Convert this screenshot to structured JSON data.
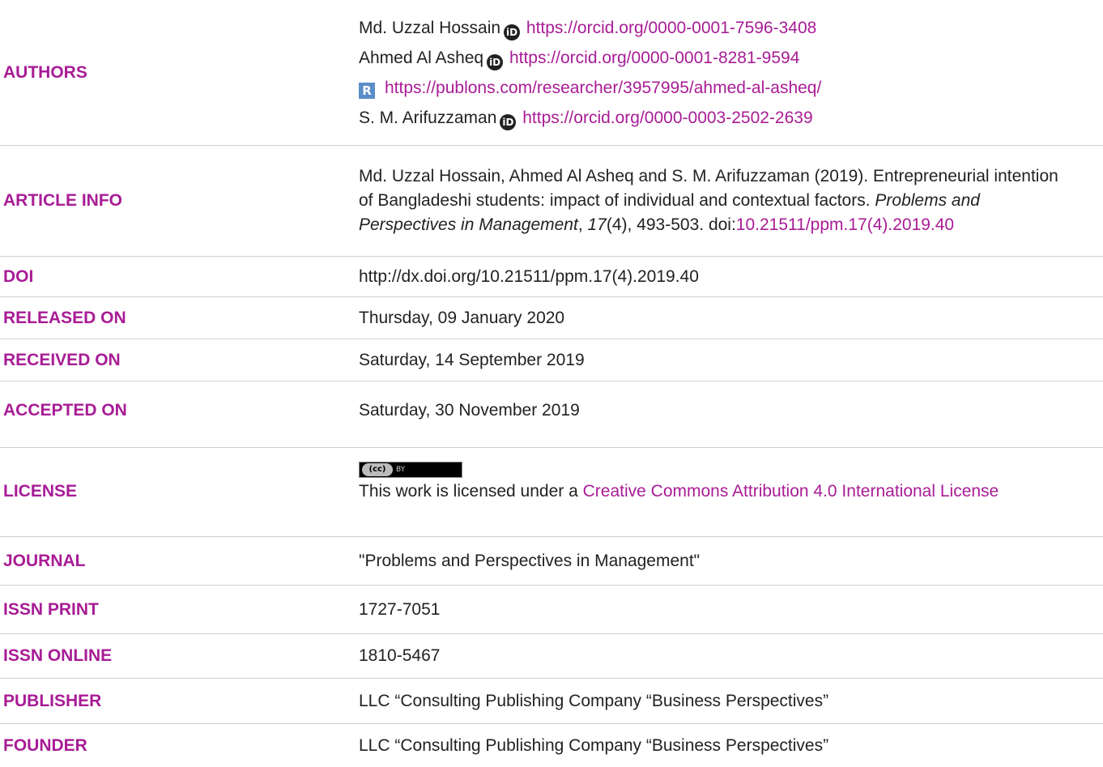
{
  "authors": {
    "label": "AUTHORS",
    "people": [
      {
        "name": "Md. Uzzal Hossain",
        "orcid": "https://orcid.org/0000-0001-7596-3408"
      },
      {
        "name": "Ahmed Al Asheq",
        "orcid": "https://orcid.org/0000-0001-8281-9594",
        "publons": "https://publons.com/researcher/3957995/ahmed-al-asheq/"
      },
      {
        "name": "S. M. Arifuzzaman",
        "orcid": "https://orcid.org/0000-0003-2502-2639"
      }
    ]
  },
  "article_info": {
    "label": "ARTICLE INFO",
    "citation_authors": "Md. Uzzal Hossain, Ahmed Al Asheq and S. M. Arifuzzaman (2019).",
    "citation_title": "Entrepreneurial intention of Bangladeshi students: impact of individual and contextual factors.",
    "journal_name": "Problems and Perspectives in Management",
    "volume": "17",
    "issue_pages": "(4), 493-503.",
    "doi_prefix": "doi:",
    "doi_link": "10.21511/ppm.17(4).2019.40"
  },
  "doi": {
    "label": "DOI",
    "value": "http://dx.doi.org/10.21511/ppm.17(4).2019.40"
  },
  "released_on": {
    "label": "RELEASED ON",
    "value": "Thursday, 09 January 2020"
  },
  "received_on": {
    "label": "RECEIVED ON",
    "value": "Saturday, 14 September 2019"
  },
  "accepted_on": {
    "label": "ACCEPTED ON",
    "value": "Saturday, 30 November 2019"
  },
  "license": {
    "label": "LICENSE",
    "text": "This work is licensed under a ",
    "link_text": "Creative Commons Attribution 4.0 International License"
  },
  "journal": {
    "label": "JOURNAL",
    "value": "\"Problems and Perspectives in Management\""
  },
  "issn_print": {
    "label": "ISSN PRINT",
    "value": "1727-7051"
  },
  "issn_online": {
    "label": "ISSN ONLINE",
    "value": "1810-5467"
  },
  "publisher": {
    "label": "PUBLISHER",
    "value": "LLC “Consulting Publishing Company “Business Perspectives”"
  },
  "founder": {
    "label": "FOUNDER",
    "value": "LLC “Consulting Publishing Company “Business Perspectives”"
  },
  "colors": {
    "accent": "#a81c95",
    "text": "#222222",
    "divider": "#cfcfcf"
  }
}
